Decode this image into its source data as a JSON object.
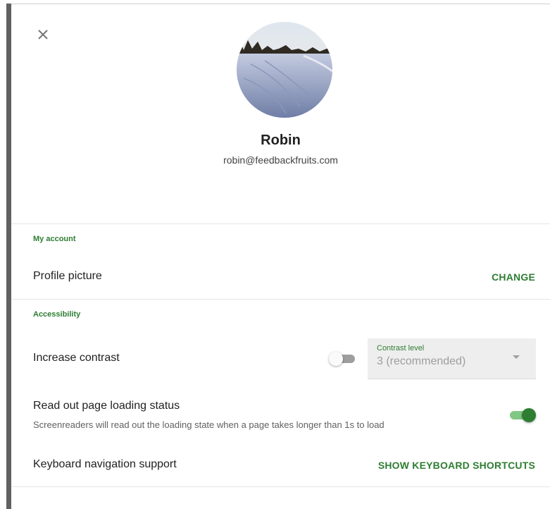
{
  "profile": {
    "name": "Robin",
    "email": "robin@feedbackfruits.com"
  },
  "sections": {
    "my_account": {
      "title": "My account",
      "profile_picture_label": "Profile picture",
      "change_label": "CHANGE"
    },
    "accessibility": {
      "title": "Accessibility",
      "increase_contrast_label": "Increase contrast",
      "increase_contrast_enabled": false,
      "contrast_select": {
        "label": "Contrast level",
        "value": "3 (recommended)"
      },
      "read_loading_label": "Read out page loading status",
      "read_loading_desc": "Screenreaders will read out the loading state when a page takes longer than 1s to load",
      "read_loading_enabled": true,
      "keyboard_label": "Keyboard navigation support",
      "keyboard_button": "SHOW KEYBOARD SHORTCUTS"
    }
  },
  "icons": {
    "close": "close-icon",
    "dropdown": "arrow-drop-down-icon"
  },
  "colors": {
    "accent": "#2e7d32",
    "toggle_on_track": "#81c784",
    "toggle_off_track": "#9e9e9e"
  }
}
